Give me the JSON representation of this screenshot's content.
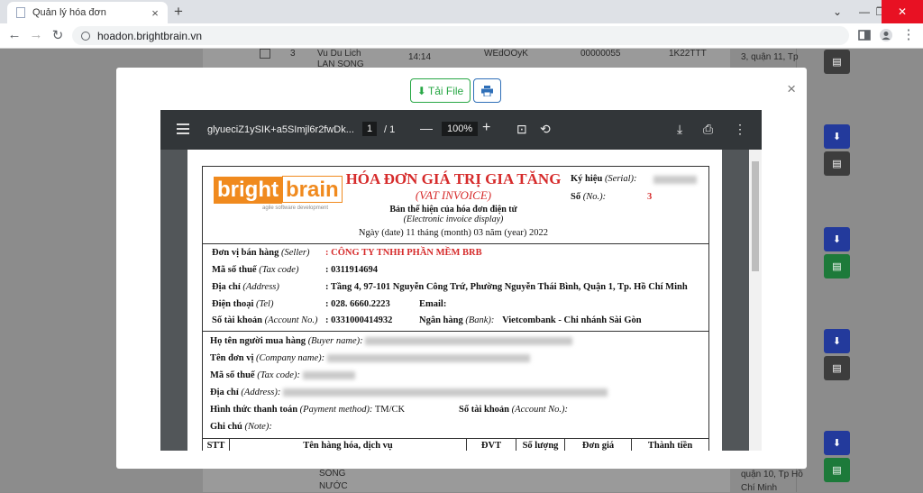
{
  "browser": {
    "tab_title": "Quản lý hóa đơn",
    "tab_close": "×",
    "new_tab": "+",
    "url": "hoadon.brightbrain.vn",
    "back": "←",
    "forward": "→",
    "reload": "↻"
  },
  "background": {
    "texts": [
      "3",
      "Vu Du Lich",
      "LAN SONG",
      "14:14",
      "WEdOOyK",
      "00000055",
      "1K22TTT",
      "3, quận 11, Tp",
      "SÓNG",
      "NƯỚC",
      "quận 10, Tp Hồ",
      "Chí Minh"
    ]
  },
  "modal": {
    "download_label": "Tải File",
    "close": "×"
  },
  "viewer": {
    "file_name": "glyueciZ1ySIK+a5SImjl6r2fwDk...",
    "page_current": "1",
    "page_total": "/ 1",
    "zoom": "100%",
    "minus": "—",
    "plus": "+"
  },
  "invoice": {
    "logo_left": "bright",
    "logo_right": "brain",
    "logo_tagline": "agile software development",
    "title": "HÓA ĐƠN GIÁ TRỊ GIA TĂNG",
    "title_en": "(VAT INVOICE)",
    "subtitle": "Bản thể hiện của hóa đơn điện tử",
    "subtitle_en": "(Electronic invoice display)",
    "date_line": "Ngày (date) 11 tháng (month) 03 năm (year) 2022",
    "serial_label": "Ký hiệu",
    "serial_label_en": "(Serial):",
    "no_label": "Số",
    "no_label_en": "(No.):",
    "no_value": "3",
    "seller": {
      "name_label": "Đơn vị bán hàng",
      "name_label_en": "(Seller)",
      "name_value": ": CÔNG TY TNHH PHẦN MỀM BRB",
      "tax_label": "Mã số thuế",
      "tax_label_en": "(Tax code)",
      "tax_value": ": 0311914694",
      "address_label": "Địa chỉ",
      "address_label_en": "(Address)",
      "address_value": ": Tầng 4, 97-101 Nguyễn Công Trứ, Phường Nguyễn Thái Bình, Quận 1, Tp. Hồ Chí Minh",
      "tel_label": "Điện thoại",
      "tel_label_en": "(Tel)",
      "tel_value": ": 028. 6660.2223",
      "email_label": "Email:",
      "account_label": "Số tài khoản",
      "account_label_en": "(Account No.)",
      "account_value": ": 0331000414932",
      "bank_label": "Ngân hàng",
      "bank_label_en": "(Bank):",
      "bank_value": "Vietcombank - Chi nhánh Sài Gòn"
    },
    "buyer": {
      "name_label": "Họ tên người mua hàng",
      "name_label_en": "(Buyer name):",
      "company_label": "Tên đơn vị",
      "company_label_en": "(Company name):",
      "tax_label": "Mã số thuế",
      "tax_label_en": "(Tax code):",
      "address_label": "Địa chỉ",
      "address_label_en": "(Address):",
      "payment_label": "Hình thức thanh toán",
      "payment_label_en": "(Payment method):",
      "payment_value": "TM/CK",
      "account_label": "Số tài khoản",
      "account_label_en": "(Account No.):",
      "note_label": "Ghi chú",
      "note_label_en": "(Note):"
    },
    "table_headers": [
      "STT",
      "Tên hàng hóa, dịch vụ",
      "ĐVT",
      "Số lượng",
      "Đơn giá",
      "Thành tiền"
    ]
  },
  "colors": {
    "accent_red": "#d62b2b",
    "brand_orange": "#f08a1e",
    "download_green": "#28a745",
    "print_blue": "#2f6fb8"
  }
}
